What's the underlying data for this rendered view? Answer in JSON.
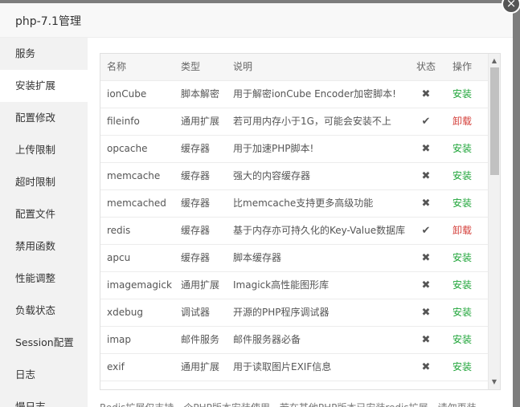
{
  "dialog": {
    "title": "php-7.1管理",
    "close_icon": "×"
  },
  "sidebar": {
    "items": [
      {
        "label": "服务"
      },
      {
        "label": "安装扩展"
      },
      {
        "label": "配置修改"
      },
      {
        "label": "上传限制"
      },
      {
        "label": "超时限制"
      },
      {
        "label": "配置文件"
      },
      {
        "label": "禁用函数"
      },
      {
        "label": "性能调整"
      },
      {
        "label": "负载状态"
      },
      {
        "label": "Session配置"
      },
      {
        "label": "日志"
      },
      {
        "label": "慢日志"
      }
    ],
    "active": "安装扩展"
  },
  "table": {
    "headers": {
      "name": "名称",
      "type": "类型",
      "desc": "说明",
      "status": "状态",
      "op": "操作"
    },
    "rows": [
      {
        "name": "ionCube",
        "type": "脚本解密",
        "desc": "用于解密ionCube Encoder加密脚本!",
        "status": "✖",
        "op": "安装"
      },
      {
        "name": "fileinfo",
        "type": "通用扩展",
        "desc": "若可用内存小于1G，可能会安装不上",
        "status": "✔",
        "op": "卸载"
      },
      {
        "name": "opcache",
        "type": "缓存器",
        "desc": "用于加速PHP脚本!",
        "status": "✖",
        "op": "安装"
      },
      {
        "name": "memcache",
        "type": "缓存器",
        "desc": "强大的内容缓存器",
        "status": "✖",
        "op": "安装"
      },
      {
        "name": "memcached",
        "type": "缓存器",
        "desc": "比memcache支持更多高级功能",
        "status": "✖",
        "op": "安装"
      },
      {
        "name": "redis",
        "type": "缓存器",
        "desc": "基于内存亦可持久化的Key-Value数据库",
        "status": "✔",
        "op": "卸载"
      },
      {
        "name": "apcu",
        "type": "缓存器",
        "desc": "脚本缓存器",
        "status": "✖",
        "op": "安装"
      },
      {
        "name": "imagemagick",
        "type": "通用扩展",
        "desc": "Imagick高性能图形库",
        "status": "✖",
        "op": "安装"
      },
      {
        "name": "xdebug",
        "type": "调试器",
        "desc": "开源的PHP程序调试器",
        "status": "✖",
        "op": "安装"
      },
      {
        "name": "imap",
        "type": "邮件服务",
        "desc": "邮件服务器必备",
        "status": "✖",
        "op": "安装"
      },
      {
        "name": "exif",
        "type": "通用扩展",
        "desc": "用于读取图片EXIF信息",
        "status": "✖",
        "op": "安装"
      },
      {
        "name": "",
        "type": "",
        "desc": "",
        "status": "",
        "op": ""
      }
    ]
  },
  "footer": {
    "note": "Redis扩展仅支持一个PHP版本安装使用，若在其他PHP版本已安装redis扩展，请勿再装"
  },
  "colors": {
    "install": "#20a53a",
    "uninstall": "#d43f3a",
    "active_sidebar_bg": "#ffffff",
    "sidebar_bg": "#f2f2f2"
  }
}
